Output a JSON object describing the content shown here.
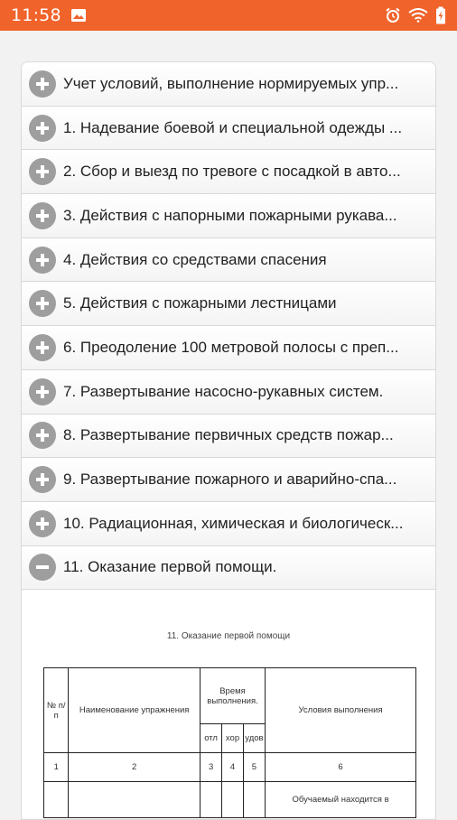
{
  "status_bar": {
    "time": "11:58",
    "color": "#f0632b",
    "left_icons": [
      "image-icon"
    ],
    "right_icons": [
      "alarm-icon",
      "wifi-icon",
      "battery-charging-icon"
    ]
  },
  "accordion": {
    "items": [
      {
        "label": "Учет условий, выполнение нормируемых упр...",
        "expanded": false
      },
      {
        "label": "1. Надевание боевой и специальной одежды ...",
        "expanded": false
      },
      {
        "label": "2. Сбор и выезд по тревоге с посадкой в авто...",
        "expanded": false
      },
      {
        "label": "3. Действия с напорными пожарными рукава...",
        "expanded": false
      },
      {
        "label": "4. Действия со средствами спасения",
        "expanded": false
      },
      {
        "label": "5. Действия с пожарными лестницами",
        "expanded": false
      },
      {
        "label": "6. Преодоление 100 метровой полосы с преп...",
        "expanded": false
      },
      {
        "label": "7. Развертывание насосно-рукавных систем.",
        "expanded": false
      },
      {
        "label": "8. Развертывание первичных средств пожар...",
        "expanded": false
      },
      {
        "label": "9. Развертывание пожарного и аварийно-спа...",
        "expanded": false
      },
      {
        "label": "10. Радиационная, химическая и биологическ...",
        "expanded": false
      },
      {
        "label": "11. Оказание первой помощи.",
        "expanded": true
      }
    ]
  },
  "document": {
    "title": "11. Оказание первой помощи",
    "table": {
      "col_num": "№ п/п",
      "col_name": "Наименование упражнения",
      "col_time": "Время выполнения.",
      "col_time_sub": [
        "отл",
        "хор",
        "удов"
      ],
      "col_conditions": "Условия выполнения",
      "numbering": [
        "1",
        "2",
        "3",
        "4",
        "5",
        "6"
      ],
      "first_row_conditions": "Обучаемый находится в"
    }
  }
}
